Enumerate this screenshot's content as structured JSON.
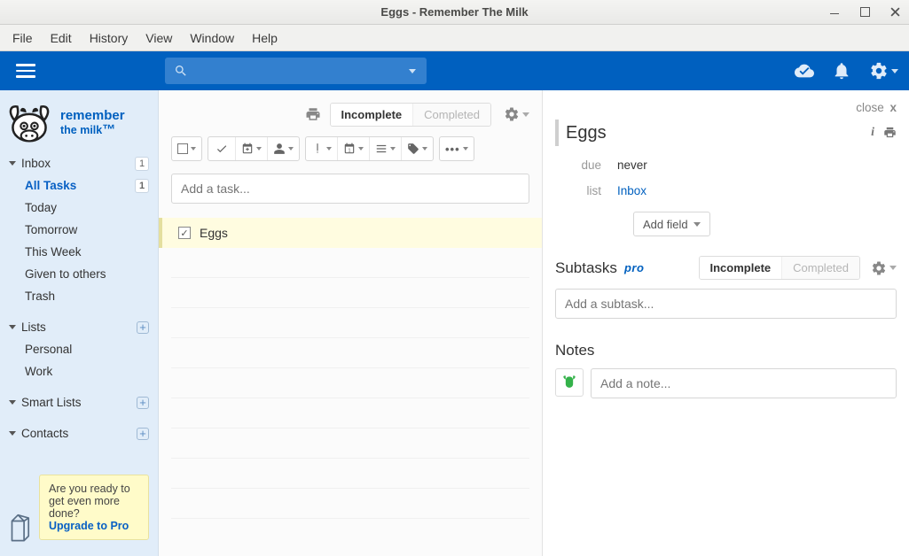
{
  "window": {
    "title": "Eggs - Remember The Milk"
  },
  "menubar": [
    "File",
    "Edit",
    "History",
    "View",
    "Window",
    "Help"
  ],
  "logo": {
    "line1": "remember",
    "line2": "the milk"
  },
  "sidebar": {
    "inbox": {
      "label": "Inbox",
      "count": "1"
    },
    "inbox_children": [
      {
        "label": "All Tasks",
        "count": "1",
        "active": true
      },
      {
        "label": "Today"
      },
      {
        "label": "Tomorrow"
      },
      {
        "label": "This Week"
      },
      {
        "label": "Given to others"
      },
      {
        "label": "Trash"
      }
    ],
    "lists": {
      "label": "Lists"
    },
    "lists_children": [
      {
        "label": "Personal"
      },
      {
        "label": "Work"
      }
    ],
    "smartlists": {
      "label": "Smart Lists"
    },
    "contacts": {
      "label": "Contacts"
    }
  },
  "upgrade": {
    "text": "Are you ready to get even more done?",
    "cta": "Upgrade to Pro"
  },
  "center": {
    "tab_incomplete": "Incomplete",
    "tab_completed": "Completed",
    "add_placeholder": "Add a task...",
    "task_name": "Eggs"
  },
  "detail": {
    "close_label": "close",
    "title": "Eggs",
    "due_label": "due",
    "due_value": "never",
    "list_label": "list",
    "list_value": "Inbox",
    "add_field": "Add field",
    "subtasks_label": "Subtasks",
    "pro_badge": "pro",
    "tab_incomplete": "Incomplete",
    "tab_completed": "Completed",
    "add_subtask_placeholder": "Add a subtask...",
    "notes_label": "Notes",
    "add_note_placeholder": "Add a note..."
  }
}
